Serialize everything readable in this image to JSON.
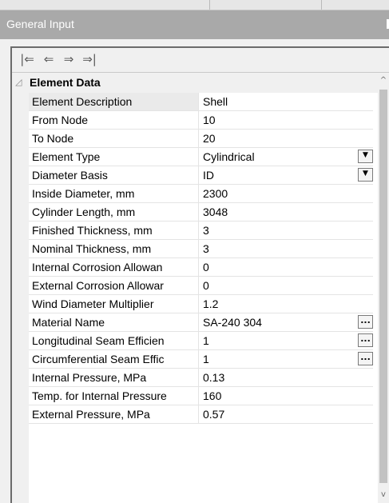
{
  "panel": {
    "title": "General Input"
  },
  "toolbar": {
    "buttons": [
      {
        "icon": "first-icon",
        "glyph": "|⇐"
      },
      {
        "icon": "previous-icon",
        "glyph": "⇐"
      },
      {
        "icon": "next-icon",
        "glyph": "⇒"
      },
      {
        "icon": "last-icon",
        "glyph": "⇒|"
      }
    ]
  },
  "category": {
    "label": "Element Data",
    "collapse_glyph": "◿"
  },
  "properties": [
    {
      "name": "Element Description",
      "value": "Shell",
      "control": "none"
    },
    {
      "name": "From Node",
      "value": "10",
      "control": "none"
    },
    {
      "name": "To Node",
      "value": "20",
      "control": "none"
    },
    {
      "name": "Element Type",
      "value": "Cylindrical",
      "control": "dropdown"
    },
    {
      "name": "Diameter Basis",
      "value": "ID",
      "control": "dropdown"
    },
    {
      "name": "Inside Diameter, mm",
      "value": "2300",
      "control": "none"
    },
    {
      "name": "Cylinder Length, mm",
      "value": "3048",
      "control": "none"
    },
    {
      "name": "Finished Thickness, mm",
      "value": "3",
      "control": "none"
    },
    {
      "name": "Nominal Thickness, mm",
      "value": "3",
      "control": "none"
    },
    {
      "name": "Internal Corrosion Allowan",
      "value": "0",
      "control": "none"
    },
    {
      "name": "External Corrosion Allowar",
      "value": "0",
      "control": "none"
    },
    {
      "name": "Wind Diameter Multiplier",
      "value": "1.2",
      "control": "none"
    },
    {
      "name": "Material Name",
      "value": "SA-240 304",
      "control": "ellipsis"
    },
    {
      "name": "Longitudinal Seam Efficien",
      "value": "1",
      "control": "ellipsis"
    },
    {
      "name": "Circumferential Seam Effic",
      "value": "1",
      "control": "ellipsis"
    },
    {
      "name": "Internal Pressure, MPa",
      "value": "0.13",
      "control": "none"
    },
    {
      "name": "Temp. for Internal Pressure",
      "value": "160",
      "control": "none"
    },
    {
      "name": "External Pressure, MPa",
      "value": "0.57",
      "control": "none"
    }
  ],
  "controls": {
    "dropdown_glyph": "▼",
    "ellipsis_glyph": "..."
  },
  "scrollbar": {
    "up_glyph": "^",
    "down_glyph": "v"
  }
}
